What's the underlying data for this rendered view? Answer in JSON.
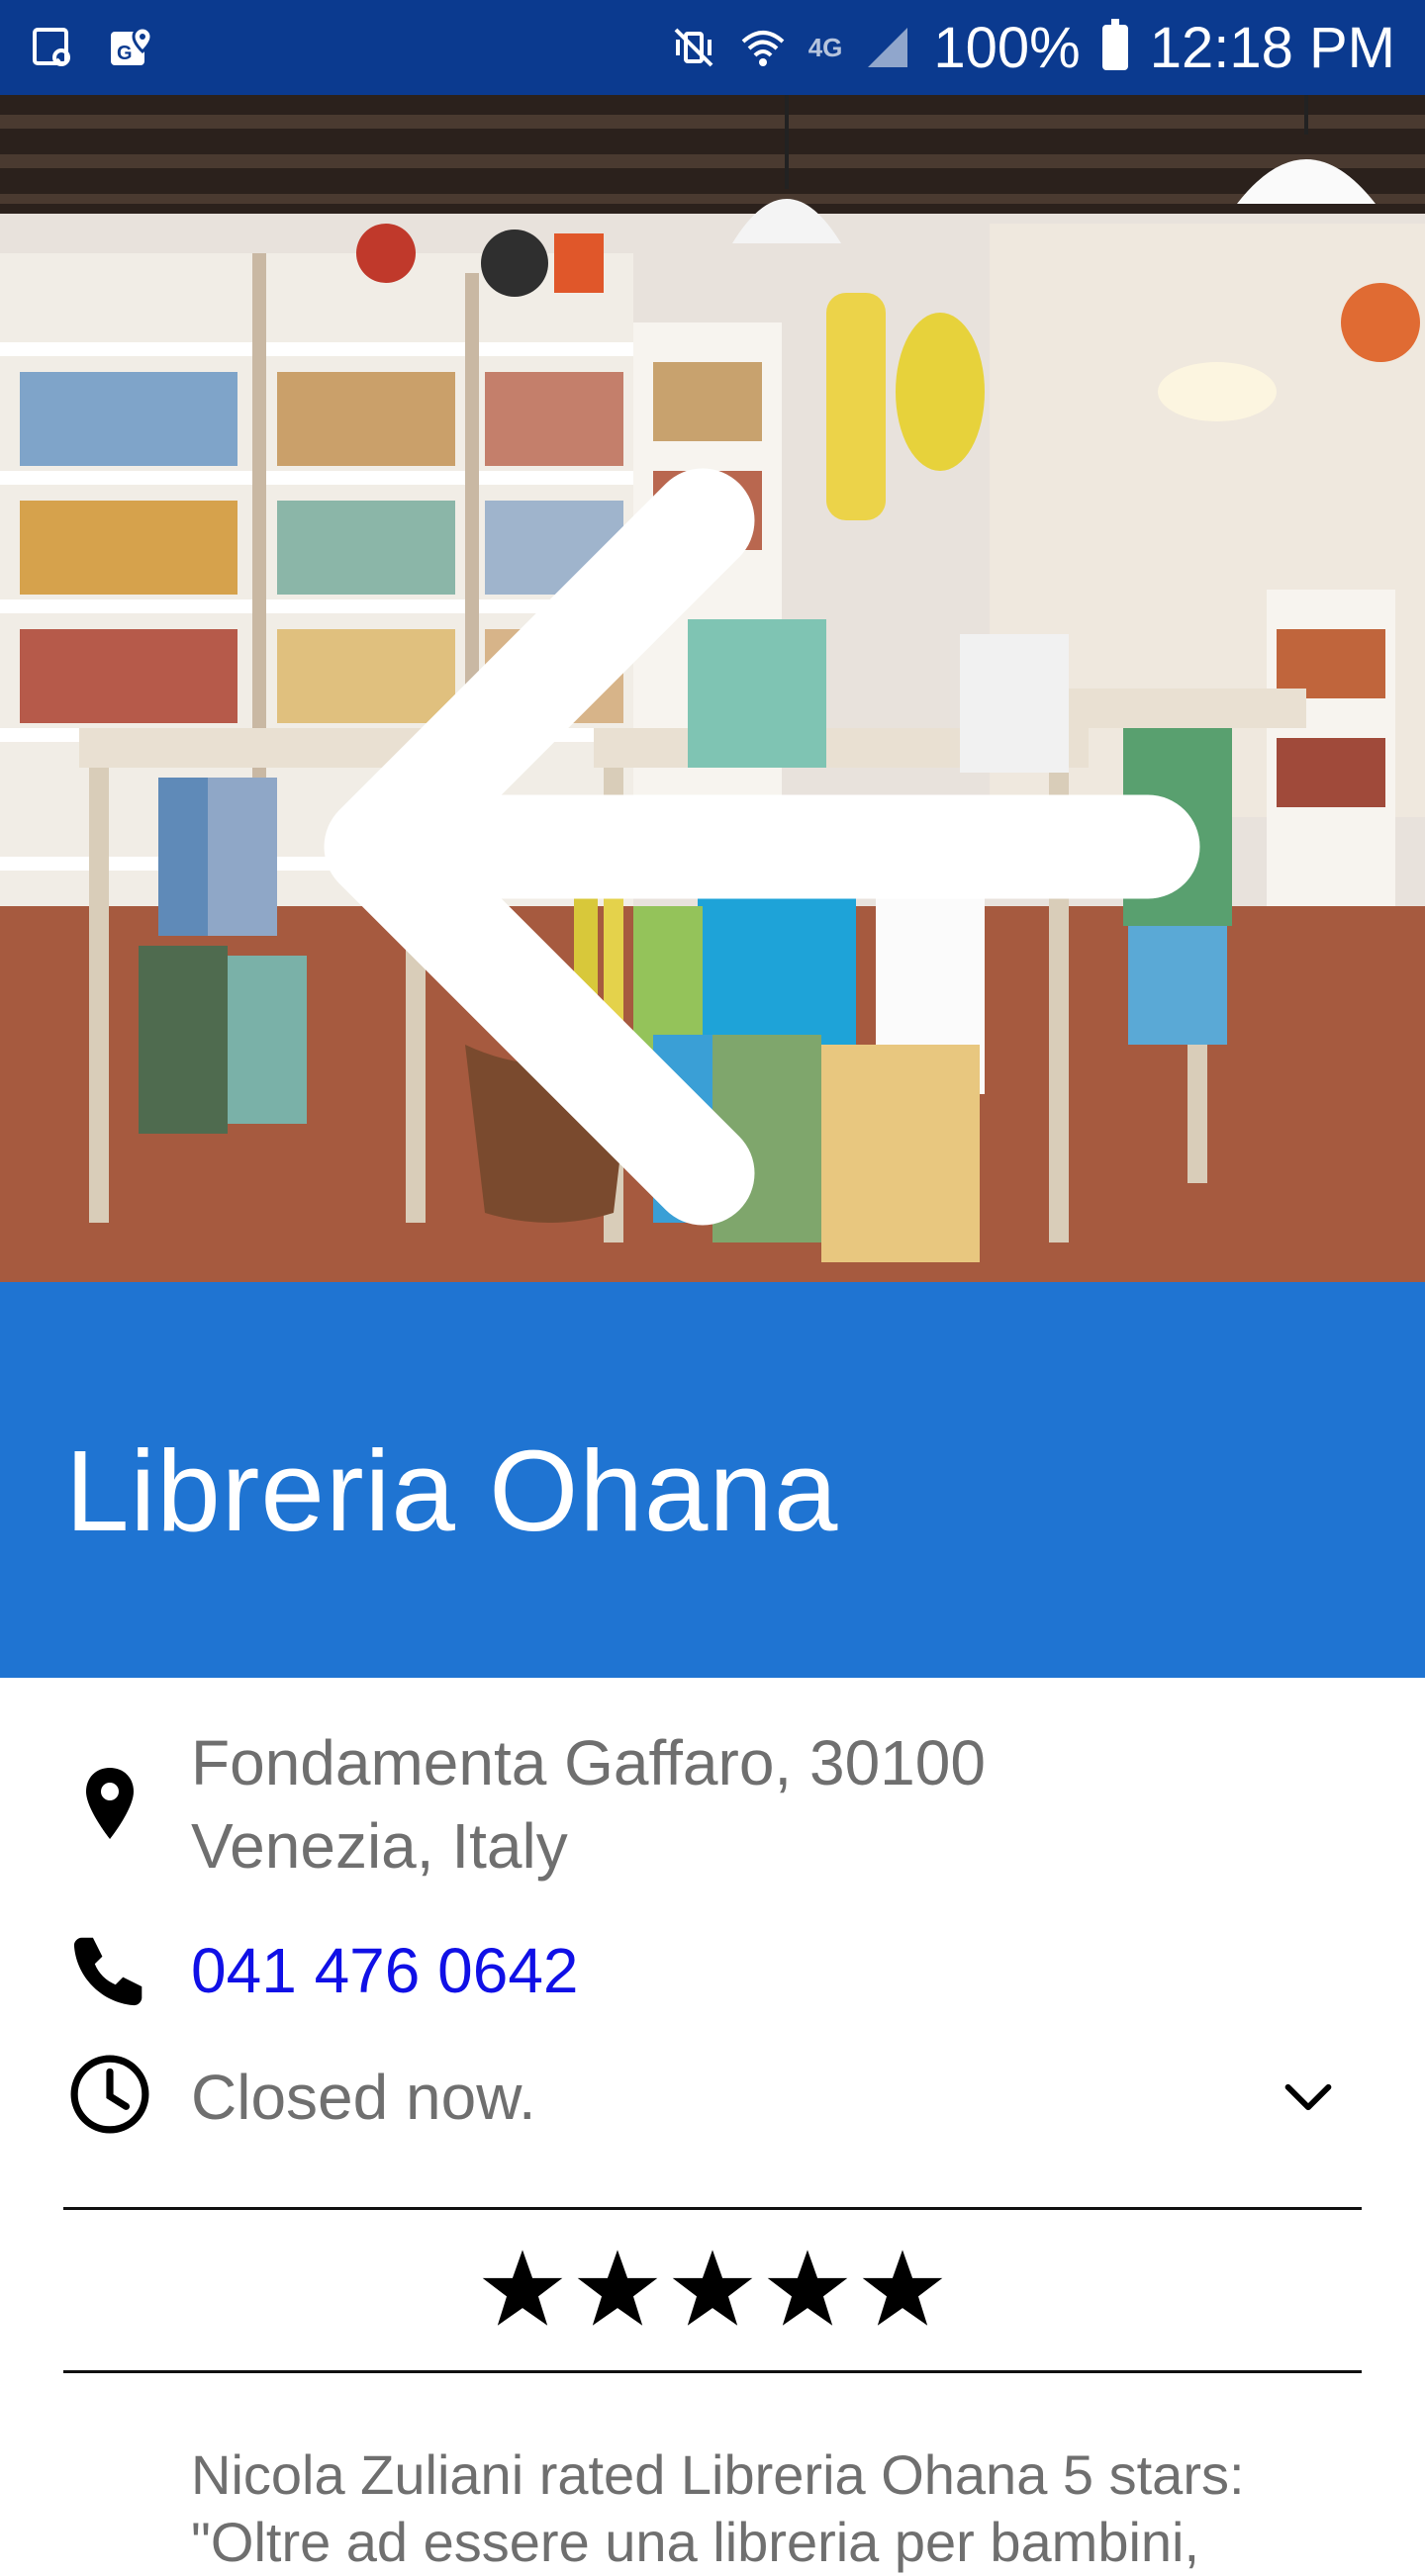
{
  "status_bar": {
    "battery": "100%",
    "time": "12:18 PM",
    "network": "4G"
  },
  "icons": {
    "back": "arrow-left-icon",
    "location": "location-pin-icon",
    "phone": "phone-icon",
    "hours": "clock-icon",
    "expand": "chevron-down-icon",
    "star": "star-icon"
  },
  "colors": {
    "status_bar": "#0b3a8f",
    "title_banner": "#1f74d2",
    "phone_link": "#1010e6",
    "secondary_text": "#6f6f6f"
  },
  "place": {
    "name": "Libreria Ohana",
    "address_line1": "Fondamenta Gaffaro, 30100",
    "address_line2": "Venezia, Italy",
    "phone": "041 476 0642",
    "hours_status": "Closed now.",
    "rating": 5,
    "rating_max": 5
  },
  "review": {
    "line1": "Nicola Zuliani rated Libreria Ohana 5 stars:",
    "line2": "\"Oltre ad essere una libreria per bambini,"
  }
}
